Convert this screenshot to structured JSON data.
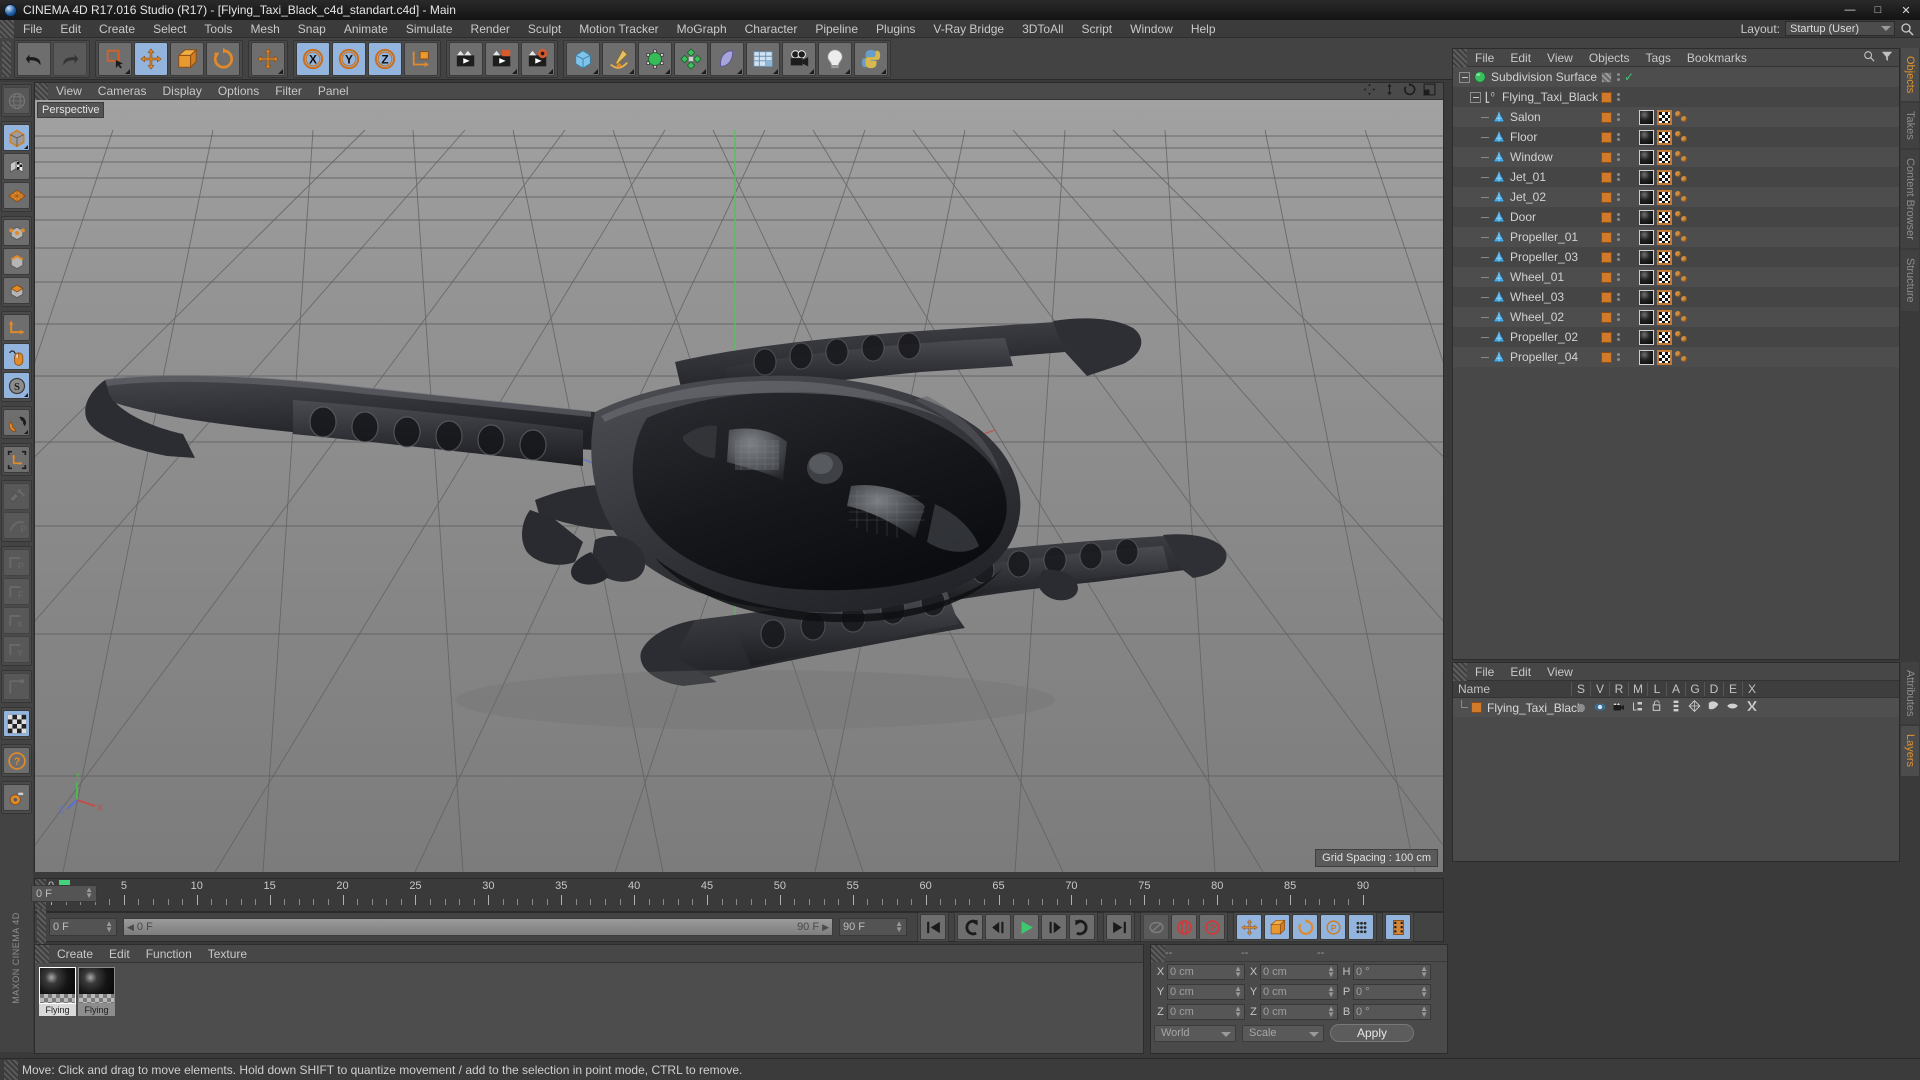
{
  "window": {
    "title": "CINEMA 4D R17.016 Studio (R17) - [Flying_Taxi_Black_c4d_standart.c4d] - Main",
    "minimize": "—",
    "maximize": "□",
    "close": "✕"
  },
  "menubar": {
    "items": [
      "File",
      "Edit",
      "Create",
      "Select",
      "Tools",
      "Mesh",
      "Snap",
      "Animate",
      "Simulate",
      "Render",
      "Sculpt",
      "Motion Tracker",
      "MoGraph",
      "Character",
      "Pipeline",
      "Plugins",
      "V-Ray Bridge",
      "3DToAll",
      "Script",
      "Window",
      "Help"
    ],
    "layout_label": "Layout:",
    "layout_value": "Startup (User)"
  },
  "viewport": {
    "menu": [
      "View",
      "Cameras",
      "Display",
      "Options",
      "Filter",
      "Panel"
    ],
    "perspective_label": "Perspective",
    "grid_spacing": "Grid Spacing : 100 cm"
  },
  "objects_panel": {
    "menu": [
      "File",
      "Edit",
      "View",
      "Objects",
      "Tags",
      "Bookmarks"
    ],
    "tree": [
      {
        "label": "Subdivision Surface",
        "depth": 0,
        "icon": "subdivision-surface-icon",
        "tags": "header"
      },
      {
        "label": "Flying_Taxi_Black",
        "depth": 1,
        "icon": "null-object-icon",
        "tags": "group"
      },
      {
        "label": "Salon",
        "depth": 2,
        "icon": "polygon-object-icon",
        "tags": "full"
      },
      {
        "label": "Floor",
        "depth": 2,
        "icon": "polygon-object-icon",
        "tags": "full"
      },
      {
        "label": "Window",
        "depth": 2,
        "icon": "polygon-object-icon",
        "tags": "full"
      },
      {
        "label": "Jet_01",
        "depth": 2,
        "icon": "polygon-object-icon",
        "tags": "full"
      },
      {
        "label": "Jet_02",
        "depth": 2,
        "icon": "polygon-object-icon",
        "tags": "full"
      },
      {
        "label": "Door",
        "depth": 2,
        "icon": "polygon-object-icon",
        "tags": "full"
      },
      {
        "label": "Propeller_01",
        "depth": 2,
        "icon": "polygon-object-icon",
        "tags": "full"
      },
      {
        "label": "Propeller_03",
        "depth": 2,
        "icon": "polygon-object-icon",
        "tags": "full"
      },
      {
        "label": "Wheel_01",
        "depth": 2,
        "icon": "polygon-object-icon",
        "tags": "full"
      },
      {
        "label": "Wheel_03",
        "depth": 2,
        "icon": "polygon-object-icon",
        "tags": "full"
      },
      {
        "label": "Wheel_02",
        "depth": 2,
        "icon": "polygon-object-icon",
        "tags": "full"
      },
      {
        "label": "Propeller_02",
        "depth": 2,
        "icon": "polygon-object-icon",
        "tags": "full"
      },
      {
        "label": "Propeller_04",
        "depth": 2,
        "icon": "polygon-object-icon",
        "tags": "full"
      }
    ]
  },
  "layers_panel": {
    "menu": [
      "File",
      "Edit",
      "View"
    ],
    "columns": [
      "Name",
      "S",
      "V",
      "R",
      "M",
      "L",
      "A",
      "G",
      "D",
      "E",
      "X"
    ],
    "rows": [
      {
        "name": "Flying_Taxi_Black",
        "color": "#d07a2a"
      }
    ]
  },
  "coordinates": {
    "header": [
      "--",
      "--",
      "--"
    ],
    "position": [
      {
        "axis": "X",
        "value": "0 cm"
      },
      {
        "axis": "Y",
        "value": "0 cm"
      },
      {
        "axis": "Z",
        "value": "0 cm"
      }
    ],
    "size": [
      {
        "axis": "X",
        "value": "0 cm"
      },
      {
        "axis": "Y",
        "value": "0 cm"
      },
      {
        "axis": "Z",
        "value": "0 cm"
      }
    ],
    "rotation": [
      {
        "axis": "H",
        "value": "0 °"
      },
      {
        "axis": "P",
        "value": "0 °"
      },
      {
        "axis": "B",
        "value": "0 °"
      }
    ],
    "system": "World",
    "mode": "Scale",
    "apply": "Apply"
  },
  "timeline": {
    "ticks": [
      0,
      5,
      10,
      15,
      20,
      25,
      30,
      35,
      40,
      45,
      50,
      55,
      60,
      65,
      70,
      75,
      80,
      85,
      90
    ],
    "end_field": "0 F",
    "current_frame": "0 F",
    "range_start": "0 F",
    "range_end": "90 F",
    "range_end_field": "90 F",
    "bar_left": "0 F",
    "bar_right": "90 F"
  },
  "materials_panel": {
    "menu": [
      "Create",
      "Edit",
      "Function",
      "Texture"
    ],
    "materials": [
      {
        "label": "Flying",
        "selected": true
      },
      {
        "label": "Flying",
        "selected": false
      }
    ]
  },
  "status": {
    "text": "Move: Click and drag to move elements. Hold down SHIFT to quantize movement / add to the selection in point mode, CTRL to remove."
  },
  "edge_tabs_top": [
    "Objects",
    "Takes",
    "Content Browser",
    "Structure"
  ],
  "edge_tabs_bottom": [
    "Attributes",
    "Layers"
  ],
  "colors": {
    "accent_orange": "#d07a2a",
    "active_blue": "#93b4dc",
    "panel_bg": "#4a4a4a",
    "toolbar_bg": "#434343",
    "play_green": "#46d17f"
  }
}
